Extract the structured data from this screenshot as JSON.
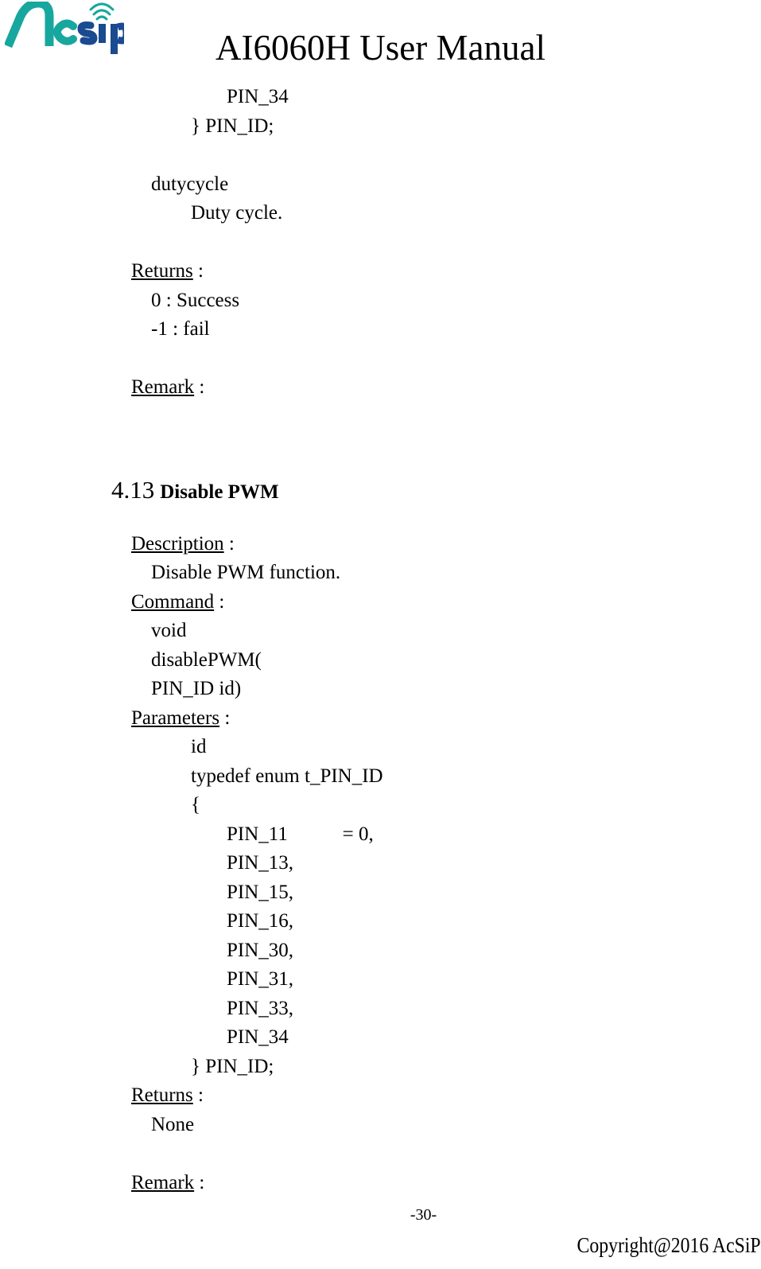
{
  "header": {
    "logo_alt": "AcSiP logo",
    "logo_text_primary": "A",
    "logo_text_secondary": "c",
    "logo_text_tertiary": "sip",
    "logo_color_teal": "#17A79E",
    "logo_color_navy": "#1A4A8F",
    "doc_title": "AI6060H User Manual"
  },
  "body_lines": [
    {
      "indent": "i4",
      "text": "PIN_34"
    },
    {
      "indent": "i3",
      "text": "} PIN_ID;"
    },
    {
      "indent": "i0",
      "text": ""
    },
    {
      "indent": "i1",
      "text": "dutycycle"
    },
    {
      "indent": "i3",
      "text": "Duty cycle."
    },
    {
      "indent": "i0",
      "text": ""
    },
    {
      "indent": "i0",
      "text": "Returns",
      "underline": true,
      "suffix": " :"
    },
    {
      "indent": "i1",
      "text": "0 : Success"
    },
    {
      "indent": "i1",
      "text": "-1 : fail"
    },
    {
      "indent": "i0",
      "text": ""
    },
    {
      "indent": "i0",
      "text": "Remark",
      "underline": true,
      "suffix": " :"
    }
  ],
  "section": {
    "number": "4.13",
    "name": "Disable PWM"
  },
  "body_lines_2": [
    {
      "indent": "i0",
      "text": "Description",
      "underline": true,
      "suffix": " :"
    },
    {
      "indent": "i1",
      "text": "Disable PWM function."
    },
    {
      "indent": "i0",
      "text": "Command",
      "underline": true,
      "suffix": " :"
    },
    {
      "indent": "i1",
      "text": "void"
    },
    {
      "indent": "i1",
      "text": "disablePWM("
    },
    {
      "indent": "i1",
      "text": "PIN_ID id)"
    },
    {
      "indent": "i0",
      "text": "Parameters",
      "underline": true,
      "suffix": " :"
    },
    {
      "indent": "i3",
      "text": "id"
    },
    {
      "indent": "i3",
      "text": "typedef enum t_PIN_ID"
    },
    {
      "indent": "i3",
      "text": "{"
    },
    {
      "indent": "i4",
      "text": "PIN_11           = 0,"
    },
    {
      "indent": "i4",
      "text": "PIN_13,"
    },
    {
      "indent": "i4",
      "text": "PIN_15,"
    },
    {
      "indent": "i4",
      "text": "PIN_16,"
    },
    {
      "indent": "i4",
      "text": "PIN_30,"
    },
    {
      "indent": "i4",
      "text": "PIN_31,"
    },
    {
      "indent": "i4",
      "text": "PIN_33,"
    },
    {
      "indent": "i4",
      "text": "PIN_34"
    },
    {
      "indent": "i3",
      "text": "} PIN_ID;"
    },
    {
      "indent": "i0",
      "text": "Returns",
      "underline": true,
      "suffix": " :"
    },
    {
      "indent": "i1",
      "text": "None"
    },
    {
      "indent": "i0",
      "text": ""
    },
    {
      "indent": "i0",
      "text": "Remark",
      "underline": true,
      "suffix": " :"
    }
  ],
  "footer": {
    "page_number": "-30-",
    "copyright": "Copyright@2016  AcSiP"
  }
}
